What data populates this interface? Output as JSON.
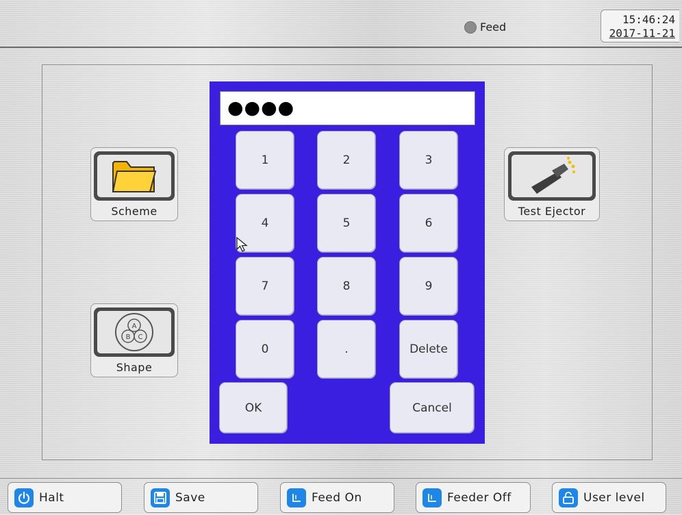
{
  "header": {
    "feed_status": "Feed",
    "feed_status_color": "#8c8c8c",
    "time": "15:46:24",
    "date": "2017-11-21"
  },
  "tiles": {
    "scheme": {
      "label": "Scheme",
      "icon": "folder-icon"
    },
    "test_ejector": {
      "label": "Test Ejector",
      "icon": "ejector-icon"
    },
    "shape": {
      "label": "Shape",
      "icon": "abc-circles-icon"
    }
  },
  "keypad": {
    "password_value": "●●●●",
    "keys": [
      "1",
      "2",
      "3",
      "4",
      "5",
      "6",
      "7",
      "8",
      "9",
      "0",
      ".",
      "Delete"
    ],
    "ok_label": "OK",
    "cancel_label": "Cancel",
    "background_color": "#3a1fe0"
  },
  "footer": {
    "buttons": [
      {
        "label": "Halt",
        "icon": "power-icon"
      },
      {
        "label": "Save",
        "icon": "floppy-disk-icon"
      },
      {
        "label": "Feed On",
        "icon": "feed-icon"
      },
      {
        "label": "Feeder Off",
        "icon": "feeder-icon"
      },
      {
        "label": "User level",
        "icon": "lock-icon"
      }
    ],
    "icon_color": "#1e86e8"
  }
}
